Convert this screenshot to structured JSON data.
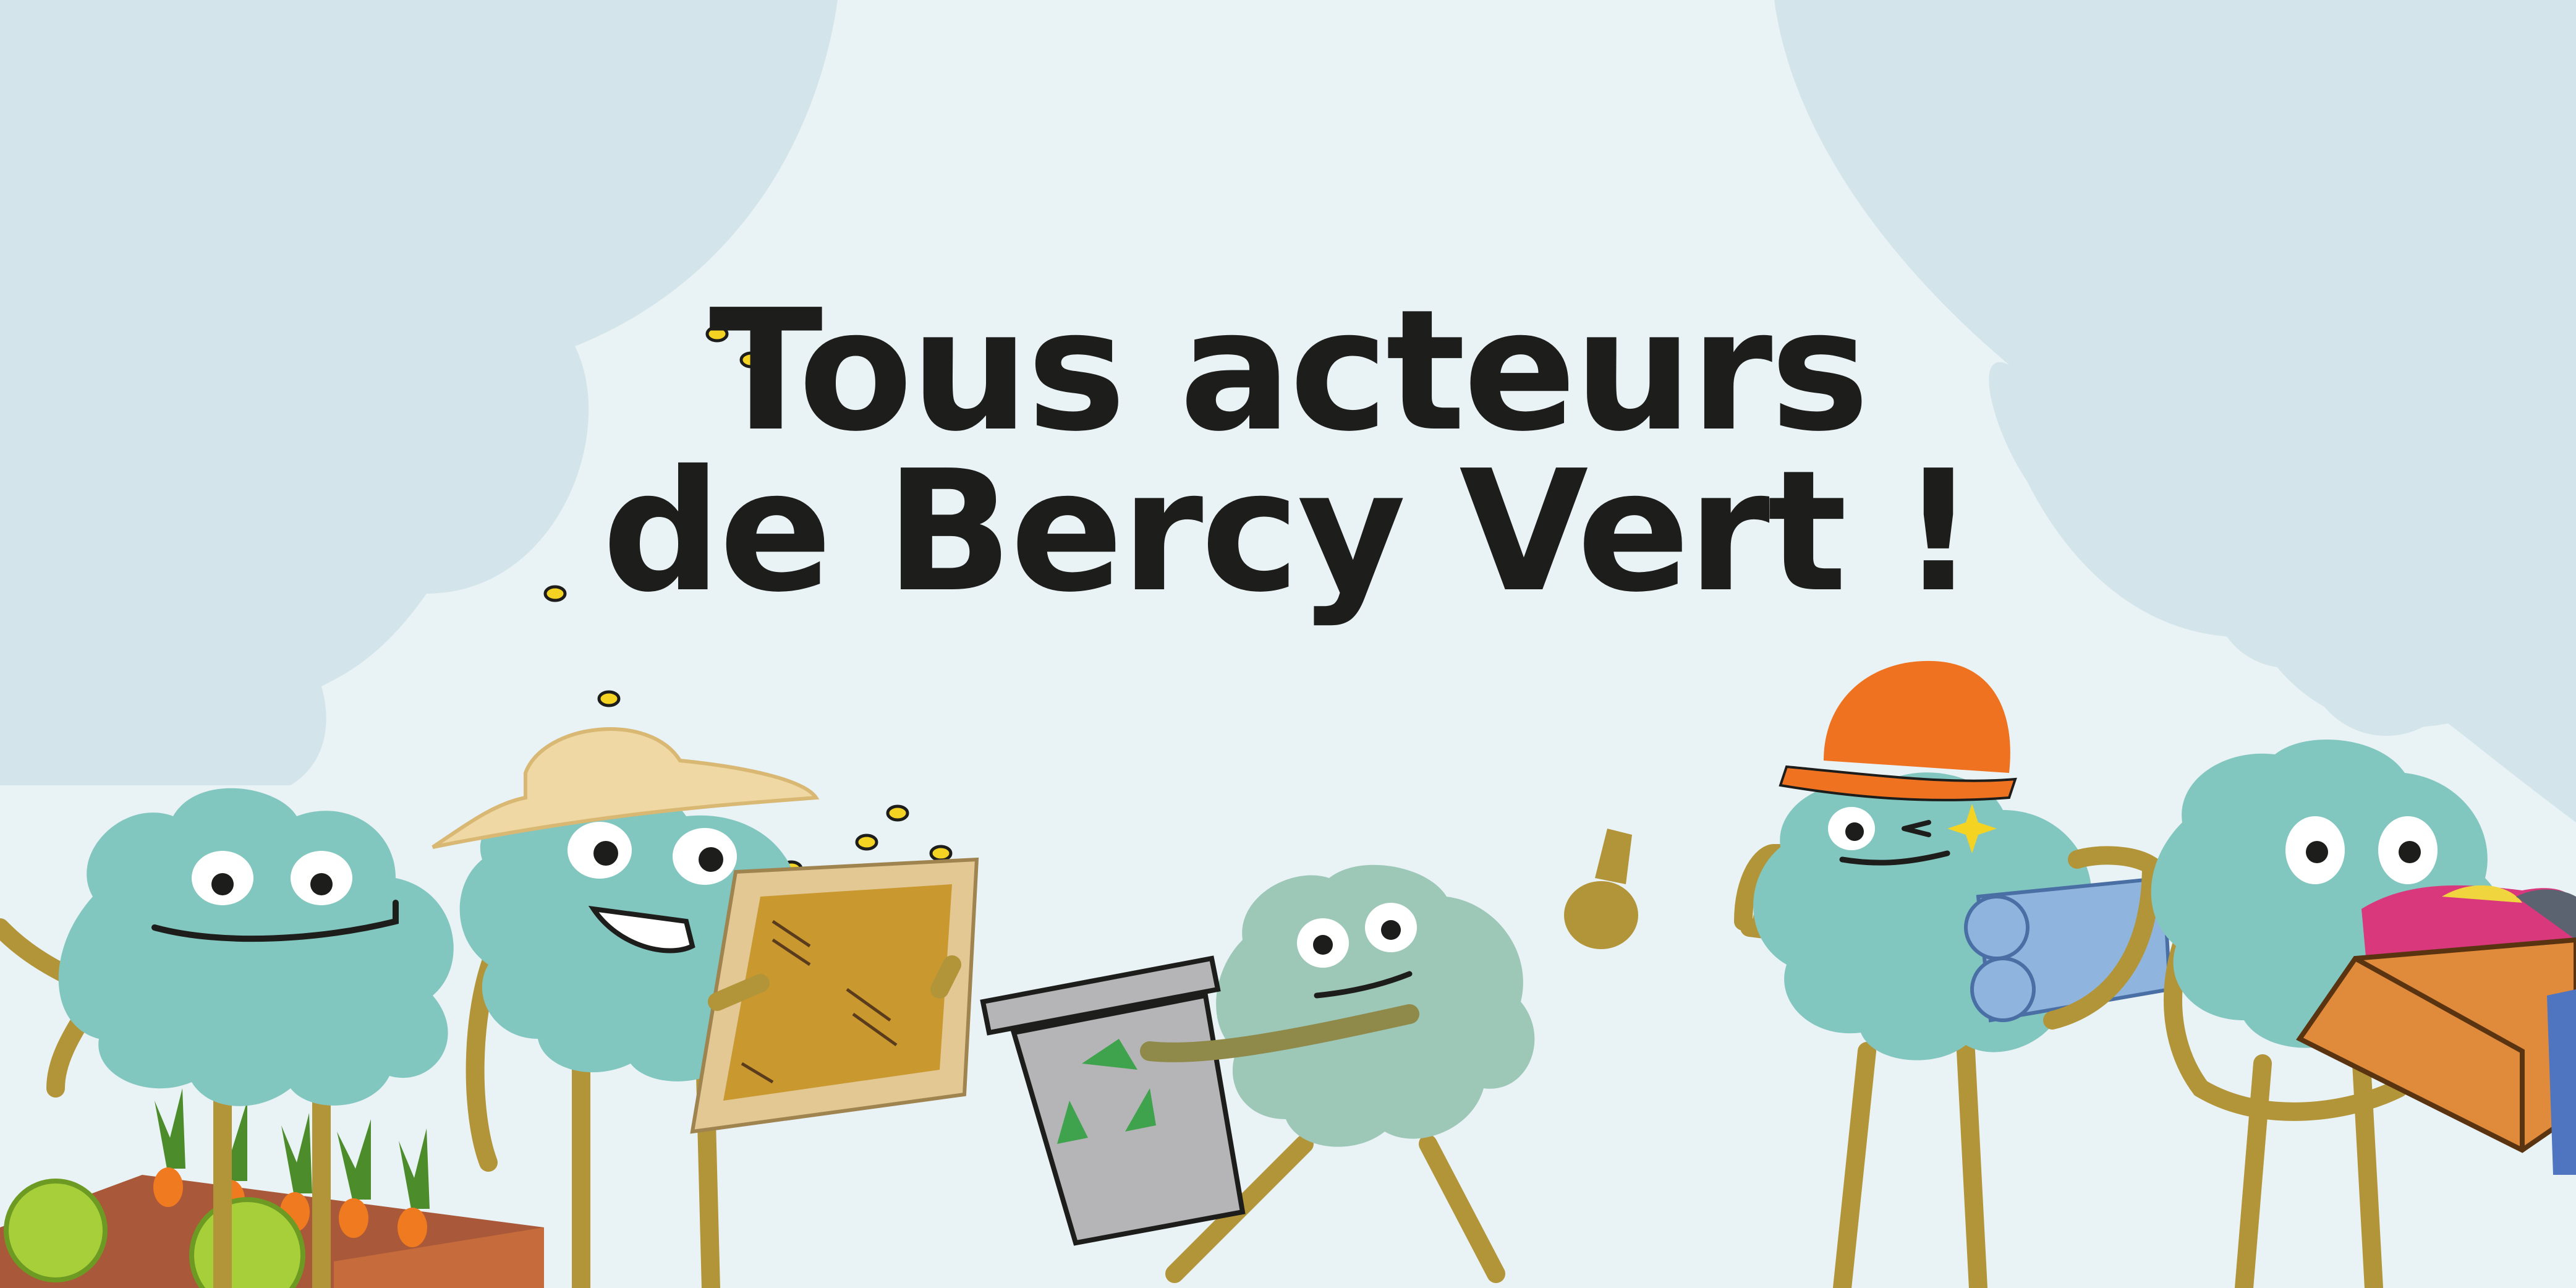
{
  "headline": {
    "line1": "Tous acteurs",
    "line2": "de Bercy Vert !"
  },
  "colors": {
    "background": "#e9f2f5",
    "cloud": "#d3e5ea",
    "character": "#82c7bf",
    "limbs": "#b39539",
    "text": "#1d1d1b",
    "helmet": "#ef7221",
    "hat": "#efd8a4",
    "crate": "#c56b3c",
    "bin": "#b5b5b7",
    "recycle": "#3fa34d"
  },
  "scene_elements": [
    "gardener",
    "beekeeper",
    "recycler",
    "worker-thumbs-up",
    "donor-with-box"
  ]
}
